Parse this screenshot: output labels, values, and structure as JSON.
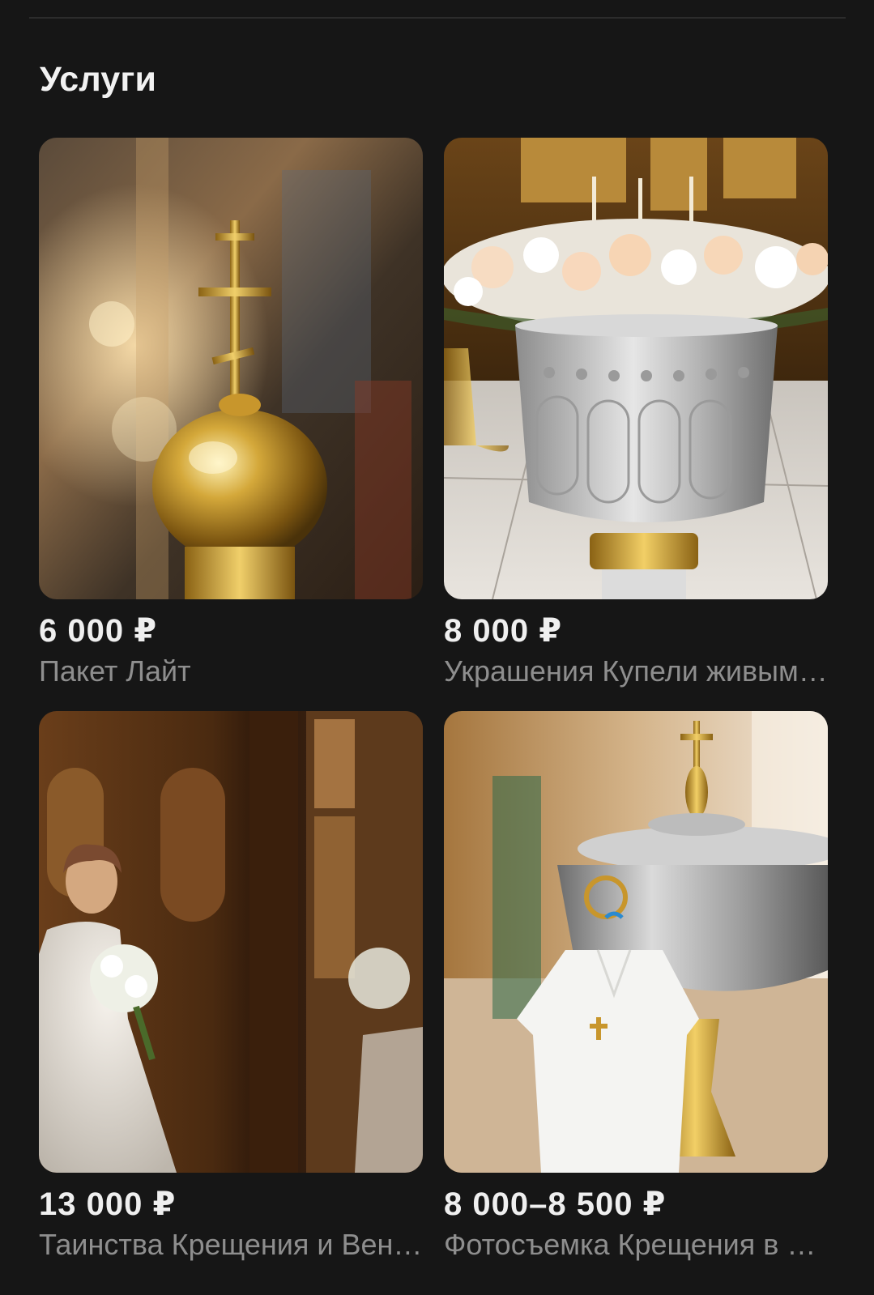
{
  "section": {
    "title": "Услуги"
  },
  "services": [
    {
      "price": "6 000 ₽",
      "name": "Пакет Лайт",
      "image": "golden-cross-dome-photo"
    },
    {
      "price": "8 000 ₽",
      "name": "Украшения Купели живыми цветами",
      "image": "decorated-font-flowers-photo"
    },
    {
      "price": "13 000 ₽",
      "name": "Таинства Крещения и Венчания",
      "image": "bride-church-photo"
    },
    {
      "price": "8 000–8 500 ₽",
      "name": "Фотосъемка Крещения в храме",
      "image": "baptismal-font-gown-photo"
    }
  ]
}
